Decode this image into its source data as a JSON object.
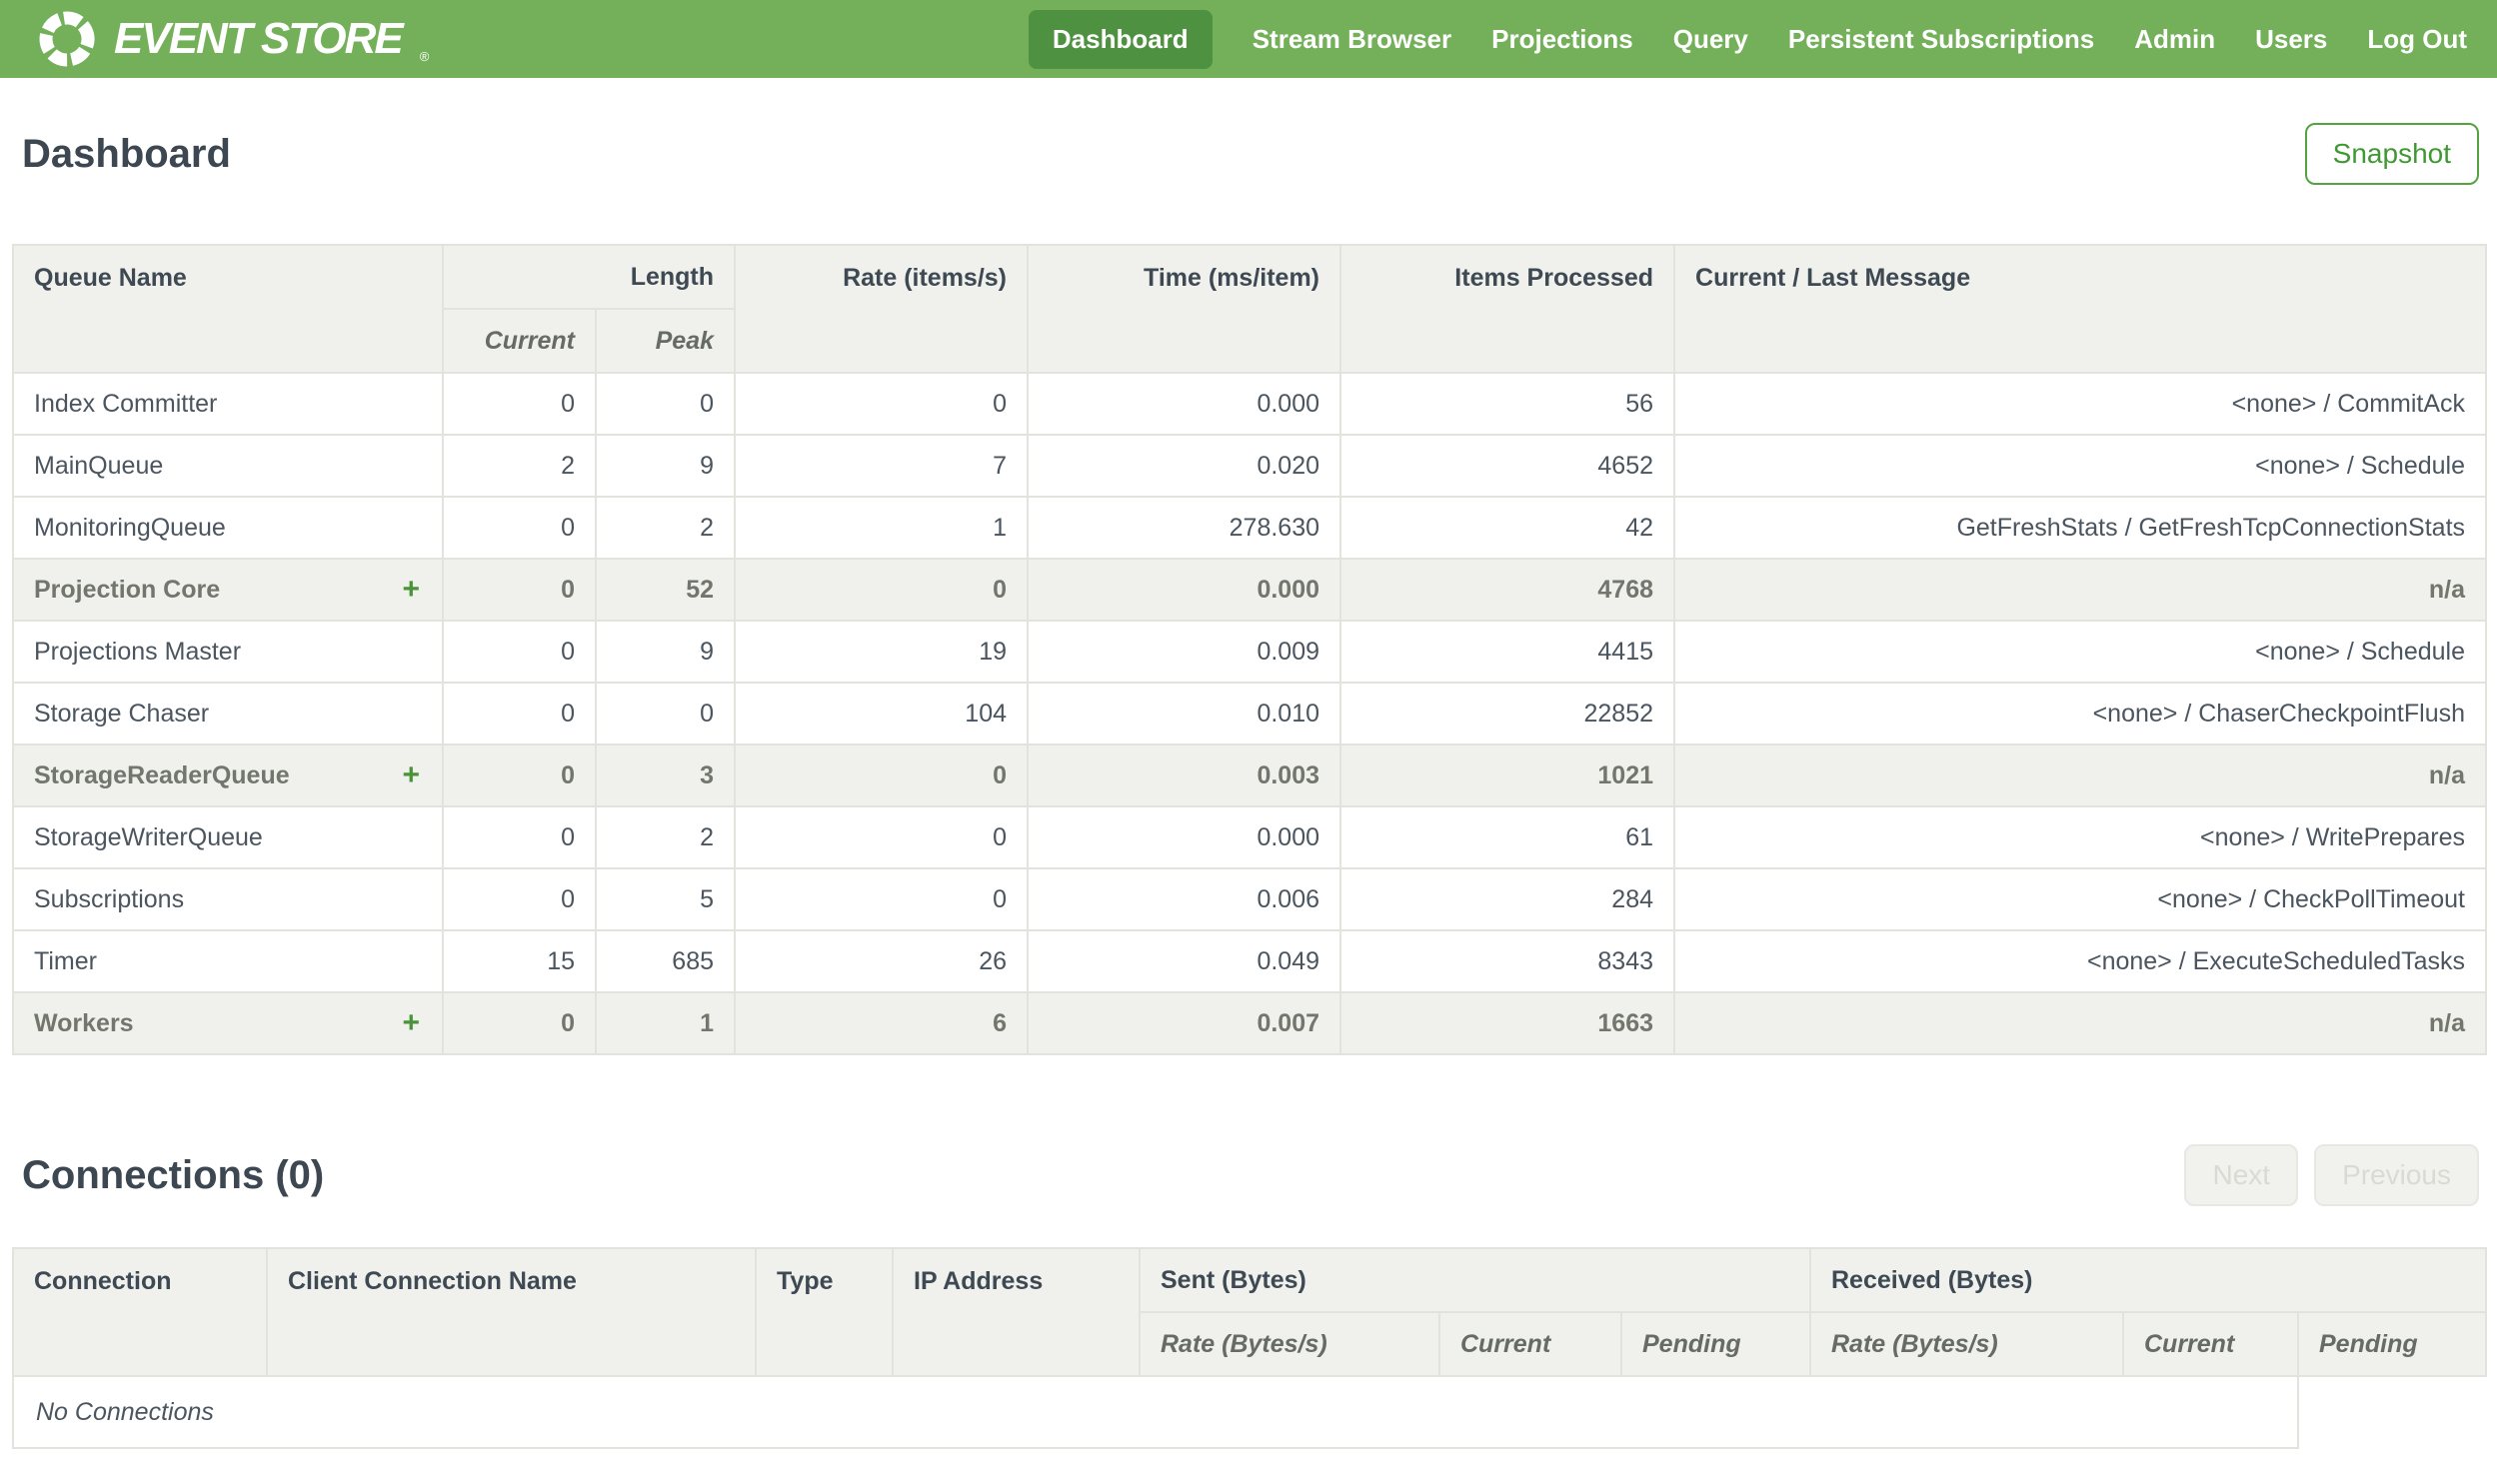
{
  "brand": {
    "name": "EVENT STORE",
    "registered_mark": "®"
  },
  "navbar": {
    "items": [
      {
        "label": "Dashboard",
        "active": true
      },
      {
        "label": "Stream Browser",
        "active": false
      },
      {
        "label": "Projections",
        "active": false
      },
      {
        "label": "Query",
        "active": false
      },
      {
        "label": "Persistent Subscriptions",
        "active": false
      },
      {
        "label": "Admin",
        "active": false
      },
      {
        "label": "Users",
        "active": false
      },
      {
        "label": "Log Out",
        "active": false
      }
    ]
  },
  "page": {
    "title": "Dashboard",
    "snapshot_button": "Snapshot"
  },
  "queues_table": {
    "expand_icon": "+",
    "headers": {
      "queue_name": "Queue Name",
      "length": "Length",
      "current": "Current",
      "peak": "Peak",
      "rate": "Rate (items/s)",
      "time": "Time (ms/item)",
      "items_processed": "Items Processed",
      "message": "Current / Last Message"
    },
    "rows": [
      {
        "name": "Index Committer",
        "group": false,
        "current": "0",
        "peak": "0",
        "rate": "0",
        "time": "0.000",
        "items": "56",
        "message": "<none> / CommitAck"
      },
      {
        "name": "MainQueue",
        "group": false,
        "current": "2",
        "peak": "9",
        "rate": "7",
        "time": "0.020",
        "items": "4652",
        "message": "<none> / Schedule"
      },
      {
        "name": "MonitoringQueue",
        "group": false,
        "current": "0",
        "peak": "2",
        "rate": "1",
        "time": "278.630",
        "items": "42",
        "message": "GetFreshStats / GetFreshTcpConnectionStats"
      },
      {
        "name": "Projection Core",
        "group": true,
        "current": "0",
        "peak": "52",
        "rate": "0",
        "time": "0.000",
        "items": "4768",
        "message": "n/a"
      },
      {
        "name": "Projections Master",
        "group": false,
        "current": "0",
        "peak": "9",
        "rate": "19",
        "time": "0.009",
        "items": "4415",
        "message": "<none> / Schedule"
      },
      {
        "name": "Storage Chaser",
        "group": false,
        "current": "0",
        "peak": "0",
        "rate": "104",
        "time": "0.010",
        "items": "22852",
        "message": "<none> / ChaserCheckpointFlush"
      },
      {
        "name": "StorageReaderQueue",
        "group": true,
        "current": "0",
        "peak": "3",
        "rate": "0",
        "time": "0.003",
        "items": "1021",
        "message": "n/a"
      },
      {
        "name": "StorageWriterQueue",
        "group": false,
        "current": "0",
        "peak": "2",
        "rate": "0",
        "time": "0.000",
        "items": "61",
        "message": "<none> / WritePrepares"
      },
      {
        "name": "Subscriptions",
        "group": false,
        "current": "0",
        "peak": "5",
        "rate": "0",
        "time": "0.006",
        "items": "284",
        "message": "<none> / CheckPollTimeout"
      },
      {
        "name": "Timer",
        "group": false,
        "current": "15",
        "peak": "685",
        "rate": "26",
        "time": "0.049",
        "items": "8343",
        "message": "<none> / ExecuteScheduledTasks"
      },
      {
        "name": "Workers",
        "group": true,
        "current": "0",
        "peak": "1",
        "rate": "6",
        "time": "0.007",
        "items": "1663",
        "message": "n/a"
      }
    ]
  },
  "connections": {
    "title": "Connections (0)",
    "next_button": "Next",
    "previous_button": "Previous",
    "headers": {
      "connection": "Connection",
      "client_connection_name": "Client Connection Name",
      "type": "Type",
      "ip_address": "IP Address",
      "sent": "Sent (Bytes)",
      "received": "Received (Bytes)",
      "rate": "Rate (Bytes/s)",
      "current": "Current",
      "pending": "Pending"
    },
    "empty_message": "No Connections"
  },
  "colors": {
    "navbar_green": "#73b059",
    "active_item_green": "#4e9140",
    "accent_green": "#47953a",
    "header_bg": "#f0f1ec",
    "text_dark": "#3d4751",
    "text_cell": "#4b555f",
    "group_text": "#72766d"
  }
}
